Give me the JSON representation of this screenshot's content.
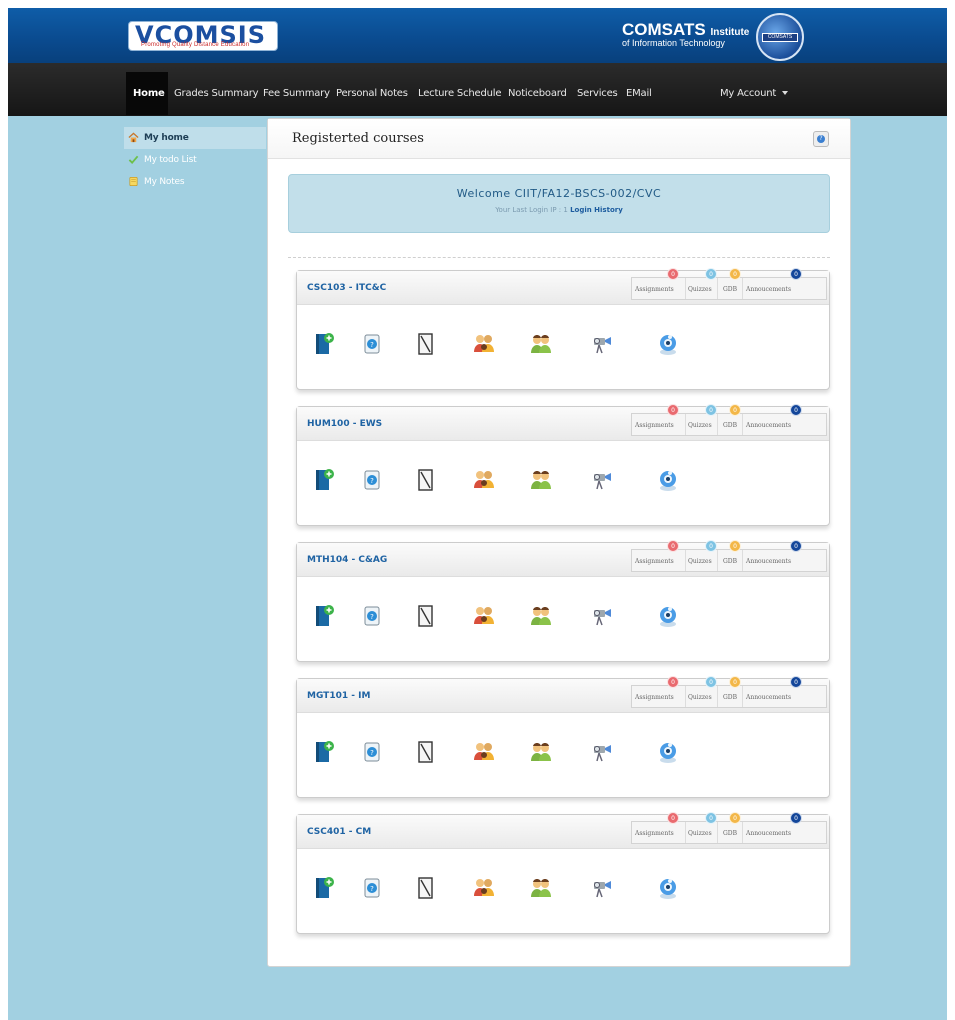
{
  "header": {
    "logo_text": "VCOMSIS",
    "logo_tagline": "Promoting Quality Distance Education",
    "institute_name": "COMSATS",
    "institute_suffix": "Institute",
    "institute_line2": "of Information Technology",
    "seal_text": "COMSATS"
  },
  "nav": {
    "items": [
      {
        "label": "Home"
      },
      {
        "label": "Grades Summary"
      },
      {
        "label": "Fee Summary"
      },
      {
        "label": "Personal Notes"
      },
      {
        "label": "Lecture Schedule"
      },
      {
        "label": "Noticeboard"
      },
      {
        "label": "Services"
      },
      {
        "label": "EMail"
      }
    ],
    "account_label": "My Account"
  },
  "sidebar": {
    "items": [
      {
        "label": "My home",
        "icon": "home-icon"
      },
      {
        "label": "My todo List",
        "icon": "checkmark-icon"
      },
      {
        "label": "My Notes",
        "icon": "notes-icon"
      }
    ]
  },
  "main": {
    "title": "Registerted courses",
    "welcome": "Welcome CIIT/FA12-BSCS-002/CVC",
    "last_login_label": "Your Last Login IP : 1",
    "login_history_label": "Login History"
  },
  "courses": [
    {
      "code": "CSC103 - ITC&C",
      "assignments": "0",
      "quizzes": "0",
      "gdb": "0",
      "announcements": "0"
    },
    {
      "code": "HUM100 - EWS",
      "assignments": "0",
      "quizzes": "0",
      "gdb": "0",
      "announcements": "0"
    },
    {
      "code": "MTH104 - C&AG",
      "assignments": "0",
      "quizzes": "0",
      "gdb": "0",
      "announcements": "0"
    },
    {
      "code": "MGT101 - IM",
      "assignments": "0",
      "quizzes": "0",
      "gdb": "0",
      "announcements": "0"
    },
    {
      "code": "CSC401 - CM",
      "assignments": "0",
      "quizzes": "0",
      "gdb": "0",
      "announcements": "0"
    }
  ],
  "stat_labels": {
    "assignments": "Assignments",
    "quizzes": "Quizzes",
    "gdb": "GDB",
    "announcements": "Annoucements"
  },
  "tool_icons": [
    "add-book-icon",
    "help-document-icon",
    "notebook-icon",
    "group-people-icon",
    "users-icon",
    "projector-icon",
    "webcam-icon"
  ],
  "colors": {
    "background": "#a2d0e1",
    "header_blue": "#0a4a8e",
    "nav_dark": "#1c1c1c",
    "badge_red": "#e96a6f",
    "badge_cyan": "#7ec3e3",
    "badge_orange": "#f3b748",
    "badge_navy": "#13469a"
  }
}
